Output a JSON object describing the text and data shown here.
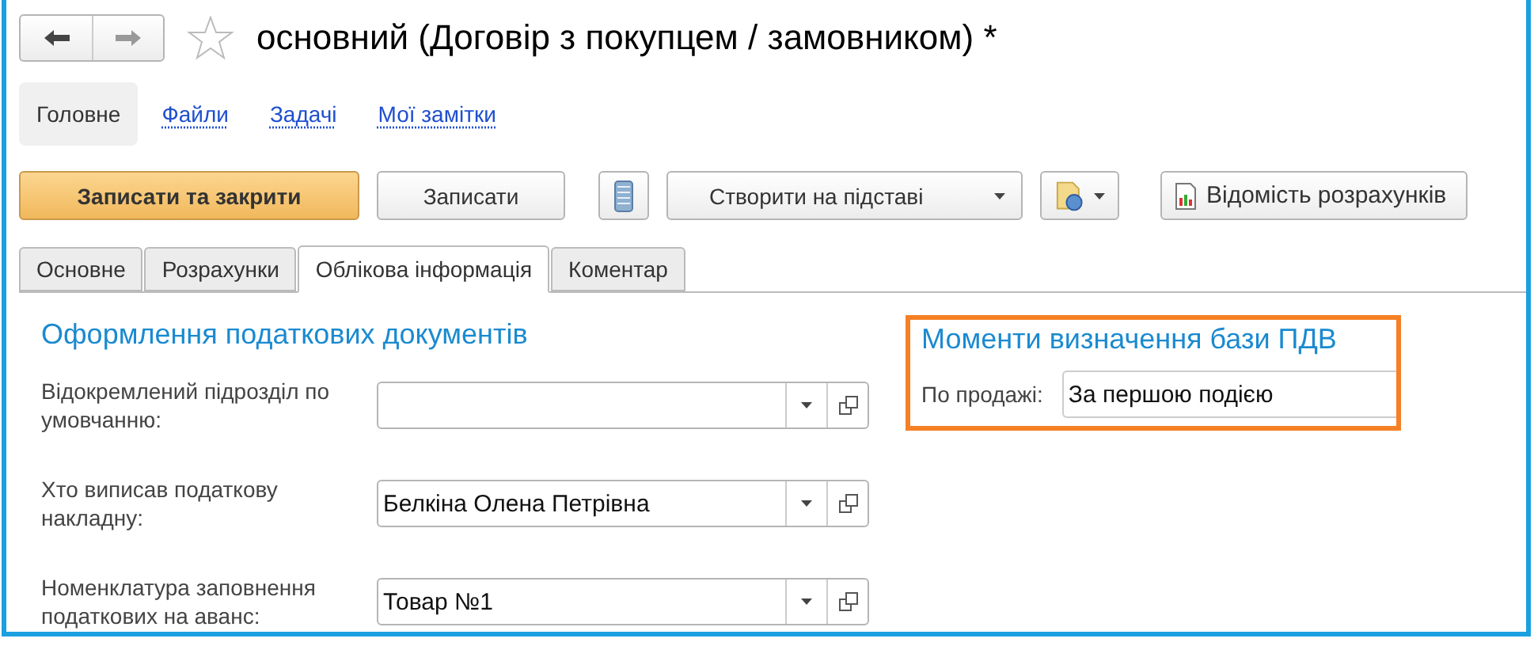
{
  "window": {
    "title": "основний (Договір з покупцем / замовником) *"
  },
  "nav": [
    {
      "label": "Головне",
      "selected": true
    },
    {
      "label": "Файли",
      "selected": false
    },
    {
      "label": "Задачі",
      "selected": false
    },
    {
      "label": "Мої замітки",
      "selected": false
    }
  ],
  "toolbar": [
    {
      "kind": "primary",
      "label": "Записати та закрити"
    },
    {
      "kind": "plain",
      "label": "Записати"
    },
    {
      "kind": "icon"
    },
    {
      "kind": "dropdown",
      "label": "Створити на підставі"
    },
    {
      "kind": "icon-dropdown"
    },
    {
      "kind": "report",
      "label": "Відомість розрахунків"
    }
  ],
  "tabs": [
    {
      "label": "Основне",
      "selected": false
    },
    {
      "label": "Розрахунки",
      "selected": false
    },
    {
      "label": "Облікова інформація",
      "selected": true
    },
    {
      "label": "Коментар",
      "selected": false
    }
  ],
  "tax_documents": {
    "title": "Оформлення податкових документів",
    "fields": [
      {
        "label": "Відокремлений підрозділ по умовчанню:"
      },
      {
        "label": "Хто виписав податкову накладну:",
        "value": "Белкіна Олена Петрівна"
      },
      {
        "label": "Номенклатура заповнення податкових на аванс:",
        "value": "Товар №1"
      }
    ]
  },
  "vat_base": {
    "title": "Моменти визначення бази ПДВ",
    "highlighted": true,
    "field": {
      "label": "По продажі:",
      "value": "За першою подією"
    }
  }
}
